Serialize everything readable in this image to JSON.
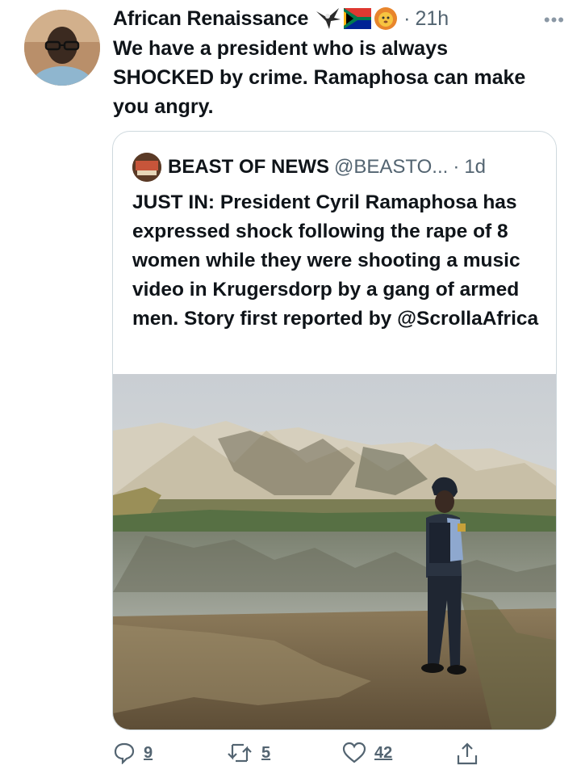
{
  "tweet": {
    "author_name": "African Renaissance",
    "dot": "·",
    "time": "21h",
    "more_icon": "more-horizontal-icon",
    "text": "We have a president who is always SHOCKED by crime. Ramaphosa can make you angry.",
    "name_emojis": [
      "eagle-emoji",
      "south-africa-flag-emoji",
      "lion-emoji"
    ]
  },
  "quoted": {
    "author_name": "BEAST OF NEWS",
    "handle": "@BEASTO...",
    "dot": "·",
    "time": "1d",
    "text": "JUST IN: President Cyril Ramaphosa has expressed shock following the rape of 8 women while they were shooting a music video in Krugersdorp by a gang of  armed men. Story first reported by @ScrollaAfrica",
    "photo_description_label": "POLICE"
  },
  "actions": {
    "replies": "9",
    "retweets": "5",
    "likes": "42"
  },
  "colors": {
    "text": "#0f1419",
    "secondary": "#536471",
    "border": "#cfd9de"
  }
}
